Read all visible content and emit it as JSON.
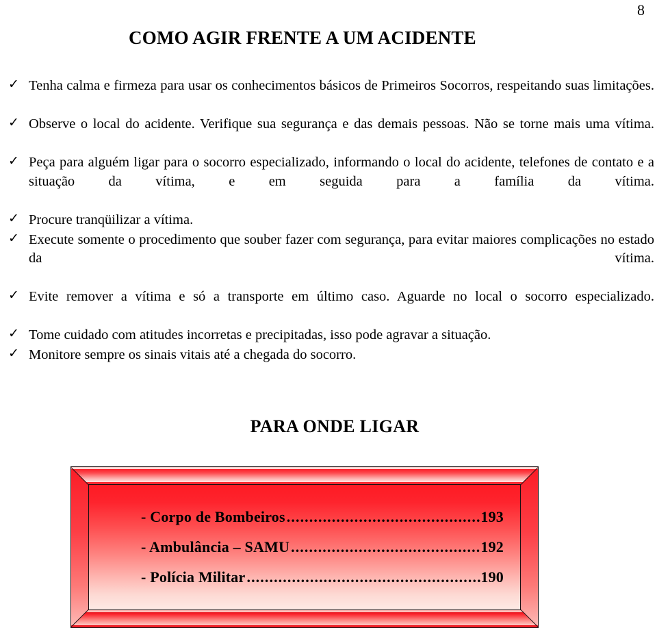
{
  "page": {
    "number": "8",
    "title": "COMO AGIR FRENTE A UM ACIDENTE",
    "subtitle": "PARA ONDE LIGAR",
    "bullet_glyph": "✓"
  },
  "checklist": {
    "items": [
      {
        "text": "Tenha calma e firmeza para usar os conhecimentos básicos de Primeiros Socorros, respeitando suas limitações.",
        "justified": true
      },
      {
        "text": "Observe o local do acidente. Verifique sua segurança e das demais pessoas. Não se torne mais uma vítima.",
        "justified": true
      },
      {
        "text": "Peça para alguém ligar para o socorro especializado, informando o local do acidente, telefones de contato e a situação da vítima, e em seguida para a família da vítima.",
        "justified": true
      },
      {
        "text": "Procure tranqüilizar a vítima.",
        "justified": false
      },
      {
        "text": "Execute somente o procedimento que souber fazer com segurança, para evitar maiores complicações no estado da vítima.",
        "justified": true
      },
      {
        "text": "Evite remover a vítima e só a transporte em último caso. Aguarde no local o socorro especializado.",
        "justified": true
      },
      {
        "text": "Tome cuidado com atitudes incorretas e precipitadas, isso pode agravar a situação.",
        "justified": false
      },
      {
        "text": "Monitore sempre os sinais vitais até a chegada do socorro.",
        "justified": false
      }
    ]
  },
  "emergency_box": {
    "frame_color": "#fe1a24",
    "panel_gradient_top": "#fe1a24",
    "panel_gradient_bottom": "#fdeae5",
    "leader": "..........................................................................",
    "rows": [
      {
        "label": "- Corpo de Bombeiros",
        "number": "193"
      },
      {
        "label": "- Ambulância – SAMU",
        "number": "192"
      },
      {
        "label": "- Polícia Militar",
        "number": "190"
      }
    ]
  }
}
